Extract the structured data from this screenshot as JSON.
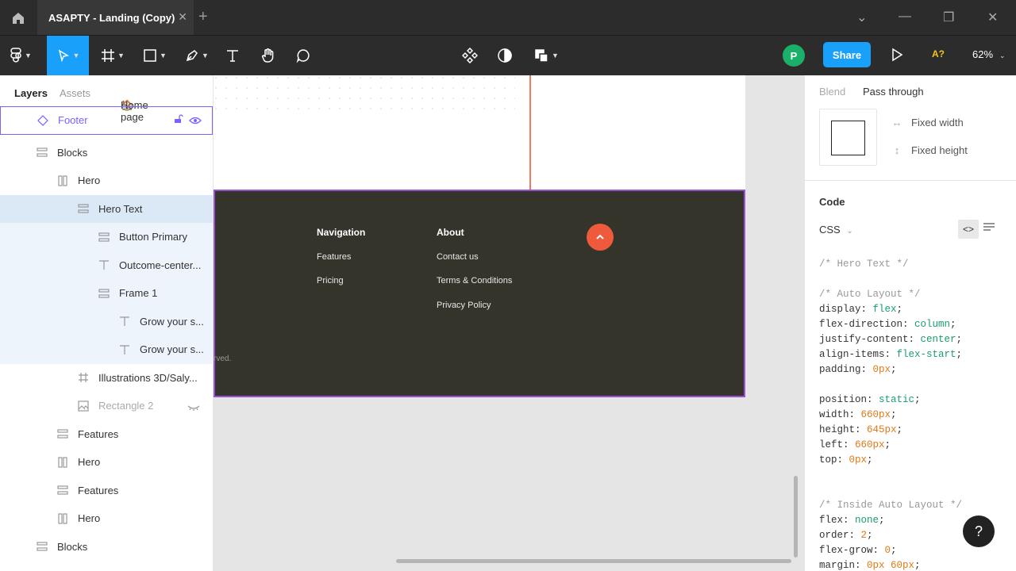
{
  "titlebar": {
    "tab_title": "ASAPTY - Landing (Copy)",
    "close": "✕",
    "new_tab": "+",
    "win_chevron": "⌄",
    "win_min": "—",
    "win_max": "❐",
    "win_close": "✕"
  },
  "toolbar": {
    "avatar_initial": "P",
    "share_label": "Share",
    "a11y_label": "A?",
    "zoom_label": "62%"
  },
  "layers_panel": {
    "tab_layers": "Layers",
    "tab_assets": "Assets",
    "page_select": "Home page",
    "items": [
      {
        "label": "Footer",
        "icon": "component-icon",
        "indent": 0
      },
      {
        "label": "Blocks",
        "icon": "stack-icon",
        "indent": 0
      },
      {
        "label": "Hero",
        "icon": "columns-icon",
        "indent": 1
      },
      {
        "label": "Hero Text",
        "icon": "stack-icon",
        "indent": 2
      },
      {
        "label": "Button Primary",
        "icon": "stack-icon",
        "indent": 3
      },
      {
        "label": "Outcome-center...",
        "icon": "text-icon",
        "indent": 3
      },
      {
        "label": "Frame 1",
        "icon": "stack-icon",
        "indent": 3
      },
      {
        "label": "Grow your s...",
        "icon": "text-icon",
        "indent": 4
      },
      {
        "label": "Grow your s...",
        "icon": "text-icon",
        "indent": 4
      },
      {
        "label": "Illustrations 3D/Saly...",
        "icon": "frame-icon",
        "indent": 2
      },
      {
        "label": "Rectangle 2",
        "icon": "image-icon",
        "indent": 2
      },
      {
        "label": "Features",
        "icon": "stack-icon",
        "indent": 1
      },
      {
        "label": "Hero",
        "icon": "columns-icon",
        "indent": 1
      },
      {
        "label": "Features",
        "icon": "stack-icon",
        "indent": 1
      },
      {
        "label": "Hero",
        "icon": "columns-icon",
        "indent": 1
      },
      {
        "label": "Blocks",
        "icon": "stack-icon",
        "indent": 0
      }
    ]
  },
  "canvas": {
    "footer": {
      "nav_heading": "Navigation",
      "nav_links": [
        "Features",
        "Pricing"
      ],
      "about_heading": "About",
      "about_links": [
        "Contact us",
        "Terms & Conditions",
        "Privacy Policy"
      ],
      "rights_fragment": "rved."
    }
  },
  "right_panel": {
    "blend_label": "Blend",
    "blend_value": "Pass through",
    "fixed_width": "Fixed width",
    "fixed_height": "Fixed height",
    "code_title": "Code",
    "css_select": "CSS",
    "code_lines": [
      [
        [
          "c-com",
          "/* Hero Text */"
        ]
      ],
      [],
      [
        [
          "c-com",
          "/* Auto Layout */"
        ]
      ],
      [
        [
          "c-prop",
          "display: "
        ],
        [
          "c-kw",
          "flex"
        ],
        [
          "c-prop",
          ";"
        ]
      ],
      [
        [
          "c-prop",
          "flex-direction: "
        ],
        [
          "c-kw",
          "column"
        ],
        [
          "c-prop",
          ";"
        ]
      ],
      [
        [
          "c-prop",
          "justify-content: "
        ],
        [
          "c-kw",
          "center"
        ],
        [
          "c-prop",
          ";"
        ]
      ],
      [
        [
          "c-prop",
          "align-items: "
        ],
        [
          "c-kw",
          "flex-start"
        ],
        [
          "c-prop",
          ";"
        ]
      ],
      [
        [
          "c-prop",
          "padding: "
        ],
        [
          "c-num",
          "0px"
        ],
        [
          "c-prop",
          ";"
        ]
      ],
      [],
      [
        [
          "c-prop",
          "position: "
        ],
        [
          "c-kw",
          "static"
        ],
        [
          "c-prop",
          ";"
        ]
      ],
      [
        [
          "c-prop",
          "width: "
        ],
        [
          "c-num",
          "660px"
        ],
        [
          "c-prop",
          ";"
        ]
      ],
      [
        [
          "c-prop",
          "height: "
        ],
        [
          "c-num",
          "645px"
        ],
        [
          "c-prop",
          ";"
        ]
      ],
      [
        [
          "c-prop",
          "left: "
        ],
        [
          "c-num",
          "660px"
        ],
        [
          "c-prop",
          ";"
        ]
      ],
      [
        [
          "c-prop",
          "top: "
        ],
        [
          "c-num",
          "0px"
        ],
        [
          "c-prop",
          ";"
        ]
      ],
      [],
      [],
      [
        [
          "c-com",
          "/* Inside Auto Layout */"
        ]
      ],
      [
        [
          "c-prop",
          "flex: "
        ],
        [
          "c-kw",
          "none"
        ],
        [
          "c-prop",
          ";"
        ]
      ],
      [
        [
          "c-prop",
          "order: "
        ],
        [
          "c-num",
          "2"
        ],
        [
          "c-prop",
          ";"
        ]
      ],
      [
        [
          "c-prop",
          "flex-grow: "
        ],
        [
          "c-num",
          "0"
        ],
        [
          "c-prop",
          ";"
        ]
      ],
      [
        [
          "c-prop",
          "margin: "
        ],
        [
          "c-num",
          "0px 60px"
        ],
        [
          "c-prop",
          ";"
        ]
      ]
    ]
  },
  "help_label": "?",
  "colors": {
    "accent": "#18a0fb",
    "footer_bg": "#35342b",
    "cta": "#f05a3c",
    "selection": "#7b61ff"
  }
}
